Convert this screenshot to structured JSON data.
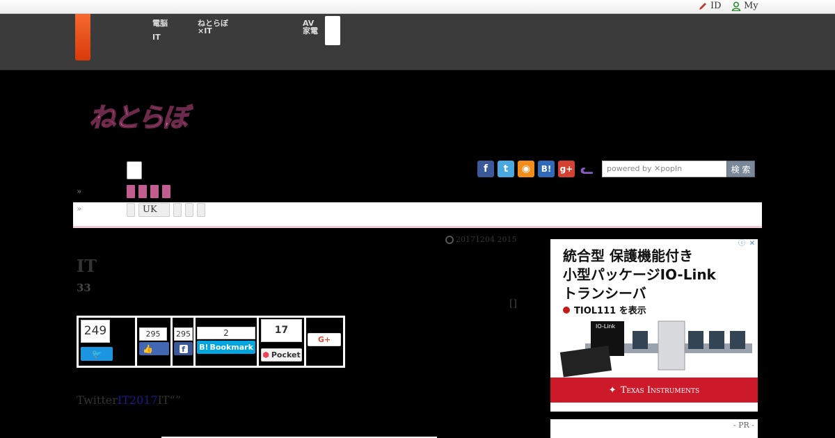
{
  "util": {
    "id_label": "ID",
    "my_label": "My"
  },
  "header": {
    "nav": [
      {
        "line1": "電脳",
        "line2": "IT"
      },
      {
        "line1": "ねとらぼ",
        "line2": "×IT"
      },
      {
        "line1": "AV",
        "line2": "家電"
      }
    ]
  },
  "logo": {
    "text": "ねとらぼ"
  },
  "breadcrumb": {
    "chevron1": "»",
    "chevron2": "»",
    "pill_uk": "UK"
  },
  "social": [
    {
      "name": "facebook-icon",
      "glyph": "f",
      "color": "#3b5998"
    },
    {
      "name": "twitter-icon",
      "glyph": "t",
      "color": "#4aa8e0"
    },
    {
      "name": "rss-icon",
      "glyph": "◉",
      "color": "#f28c1b"
    },
    {
      "name": "hatena-icon",
      "glyph": "B!",
      "color": "#2e6ab8"
    },
    {
      "name": "googleplus-icon",
      "glyph": "g+",
      "color": "#d44132"
    },
    {
      "name": "cat-icon",
      "glyph": "ᓚ",
      "color": "#8a5cc0"
    }
  ],
  "search": {
    "placeholder": "powered by ✕popIn",
    "button": "検 索"
  },
  "article": {
    "date": "20171204 2015",
    "title": "IT",
    "subtitle": "33",
    "bracket": "[]",
    "body_prefix": "Twitter",
    "body_link": "IT2017",
    "body_suffix": "IT“”"
  },
  "share": {
    "tweet_count": "249",
    "like_count": "295",
    "fb_count": "295",
    "hatena_count": "2",
    "hatena_label": "Bookmark",
    "pocket_count": "17",
    "pocket_label": "Pocket",
    "gplus_label": "G+"
  },
  "ad": {
    "line1": "統合型 保護機能付き",
    "line2": "小型パッケージIO-Link",
    "line3": "トランシーバ",
    "link": "TIOL111 を表示",
    "chip_label": "IO-Link",
    "brand": "Texas Instruments",
    "pr_label": "- PR -"
  },
  "colors": {
    "accent": "#f15a24",
    "pink": "#c15e8f",
    "ad_red": "#cc1a2a"
  }
}
